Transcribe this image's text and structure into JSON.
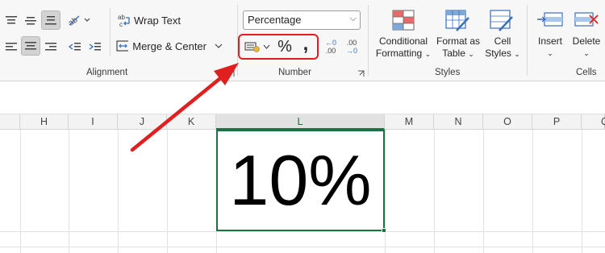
{
  "alignment": {
    "wrap_text_label": "Wrap Text",
    "merge_center_label": "Merge & Center",
    "group_label": "Alignment"
  },
  "number": {
    "format_value": "Percentage",
    "percent_symbol": "%",
    "comma_symbol": ",",
    "inc_decimal_top": "←0",
    "inc_decimal_bottom": ".00",
    "dec_decimal_top": ".00",
    "dec_decimal_bottom": "→0",
    "group_label": "Number"
  },
  "styles": {
    "conditional_formatting_line1": "Conditional",
    "conditional_formatting_line2": "Formatting",
    "format_as_table_line1": "Format as",
    "format_as_table_line2": "Table",
    "cell_styles_line1": "Cell",
    "cell_styles_line2": "Styles",
    "group_label": "Styles"
  },
  "cells": {
    "insert_label": "Insert",
    "delete_label": "Delete",
    "group_label": "Cells"
  },
  "columns": [
    "H",
    "I",
    "J",
    "K",
    "L",
    "M",
    "N",
    "O",
    "P",
    "Q"
  ],
  "selected_column": "L",
  "active_cell_value": "10%",
  "colors": {
    "highlight": "#e02020",
    "arrow": "#e02020",
    "selection": "#1e7145"
  }
}
